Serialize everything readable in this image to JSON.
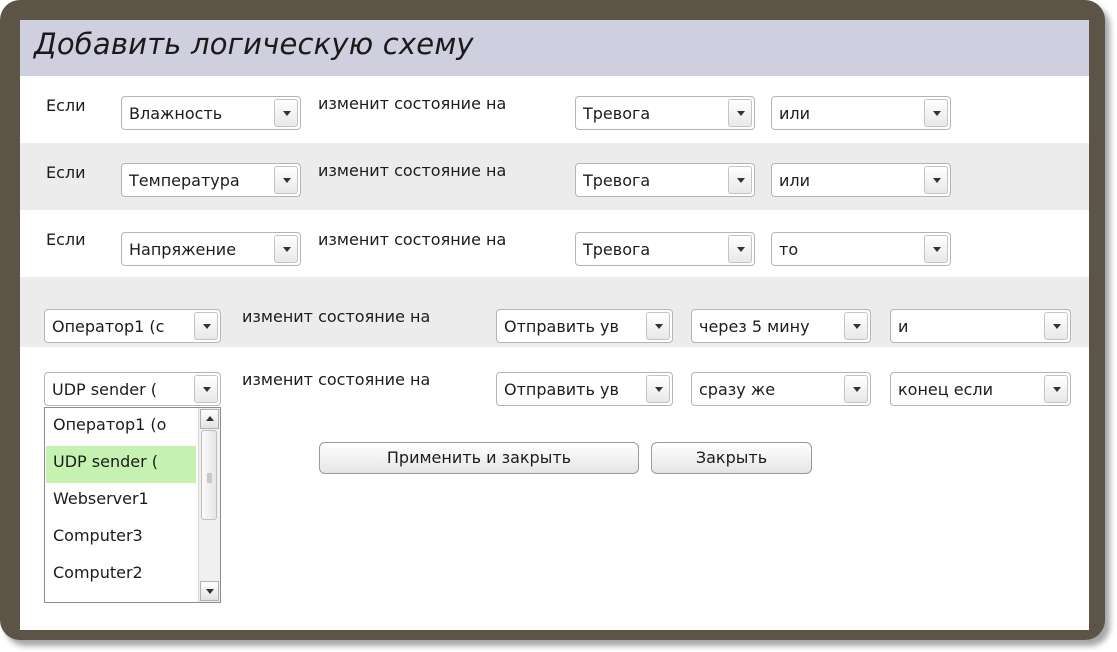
{
  "dialog": {
    "title": "Добавить логическую схему"
  },
  "rows": [
    {
      "if_label": "Если",
      "sensor": "Влажность",
      "change_label": "изменит состояние на",
      "state": "Тревога",
      "logic": "или"
    },
    {
      "if_label": "Если",
      "sensor": "Температура",
      "change_label": "изменит состояние на",
      "state": "Тревога",
      "logic": "или"
    },
    {
      "if_label": "Если",
      "sensor": "Напряжение",
      "change_label": "изменит состояние на",
      "state": "Тревога",
      "logic": "то"
    }
  ],
  "actions": [
    {
      "target": "Оператор1 (с",
      "change_label": "изменит состояние на",
      "action": "Отправить ув",
      "delay": "через 5 мину",
      "logic": "и"
    },
    {
      "target": "UDP sender (",
      "change_label": "изменит состояние на",
      "action": "Отправить ув",
      "delay": "сразу же",
      "logic": "конец если"
    }
  ],
  "dropdown_list": {
    "options": [
      "Оператор1 (о",
      "UDP sender (",
      "Webserver1",
      "Computer3",
      "Computer2"
    ],
    "selected_index": 1,
    "selected_color": "#c5f2b0"
  },
  "buttons": {
    "apply_close": "Применить и закрыть",
    "close": "Закрыть"
  },
  "colors": {
    "frame": "#5c5447",
    "title_bar": "#cfcfdf",
    "row_alt": "#ececec"
  }
}
